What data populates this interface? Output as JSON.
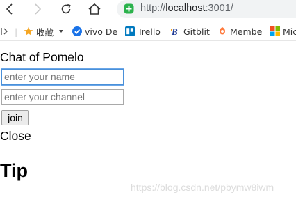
{
  "browser": {
    "url_prefix": "http://",
    "url_host": "localhost",
    "url_rest": ":3001/"
  },
  "bookmarks": [
    {
      "label": "收藏",
      "icon": "star-icon"
    },
    {
      "label": "vivo De",
      "icon": "vivo-check-icon"
    },
    {
      "label": "Trello",
      "icon": "trello-icon"
    },
    {
      "label": "Gitblit",
      "icon": "gitblit-icon"
    },
    {
      "label": "Membe",
      "icon": "member-icon"
    },
    {
      "label": "Mic",
      "icon": "microsoft-icon"
    }
  ],
  "page": {
    "title": "Chat of Pomelo",
    "name_placeholder": "enter your name",
    "channel_placeholder": "enter your channel",
    "join_label": "join",
    "close_label": "Close",
    "tip_heading": "Tip"
  },
  "watermark": "https://blog.csdn.net/pbymw8iwm",
  "colors": {
    "accent_focus": "#4a90d9",
    "secure_green": "#2bb24c"
  }
}
